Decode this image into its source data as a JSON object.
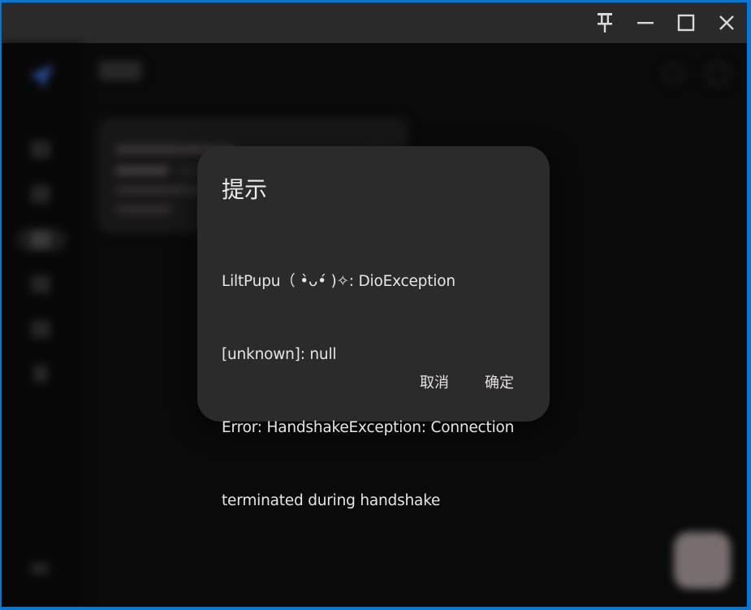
{
  "window": {
    "controls": {
      "pin_icon": "pin-icon",
      "minimize_icon": "minimize-icon",
      "maximize_icon": "maximize-icon",
      "close_icon": "close-icon"
    }
  },
  "dialog": {
    "title": "提示",
    "body_lines": [
      "LiltPupu（ •̀ᴗ•́ )✧: DioException",
      "[unknown]: null",
      "Error: HandshakeException: Connection",
      "terminated during handshake"
    ],
    "cancel_label": "取消",
    "confirm_label": "确定"
  },
  "colors": {
    "accent_border": "#0078d7",
    "dialog_bg": "#2c2b2b",
    "titlebar_bg": "#2b2a2a"
  }
}
